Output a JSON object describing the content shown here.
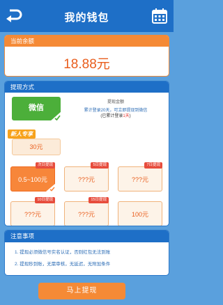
{
  "header": {
    "title": "我的钱包",
    "back_icon": "return-arrow-icon",
    "calendar_icon": "calendar-icon"
  },
  "balance": {
    "label": "当前余额",
    "amount": "18.88元"
  },
  "withdraw": {
    "label": "提现方式",
    "method": "微信",
    "new_user_tag": "新人专享",
    "new_user_amount": "30元",
    "info_title": "提现金额",
    "info_line1": "累计登录20天，可立即提现到微信",
    "info_line2_prefix": "(已累计登录",
    "info_line2_days": "1天",
    "info_line2_suffix": ")",
    "options": [
      {
        "amount": "0.5~100元",
        "tag": "次日提现",
        "selected": true
      },
      {
        "amount": "???元",
        "tag": "5日提现",
        "selected": false
      },
      {
        "amount": "???元",
        "tag": "7日提现",
        "selected": false
      },
      {
        "amount": "???元",
        "tag": "10日提现",
        "selected": false
      },
      {
        "amount": "???元",
        "tag": "15日提现",
        "selected": false
      },
      {
        "amount": "100元",
        "tag": "",
        "selected": false
      }
    ]
  },
  "notes": {
    "label": "注意事项",
    "items": [
      "1. 提现必须微信号实名认证，否则红包无法到账",
      "2. 提现秒到账，无需审核，无延迟，无附加条件"
    ]
  },
  "submit_label": "马上提现",
  "colors": {
    "header": "#1e6fc7",
    "accent": "#f58a36",
    "wechat": "#4caf3a",
    "background": "#5aa0dd"
  }
}
